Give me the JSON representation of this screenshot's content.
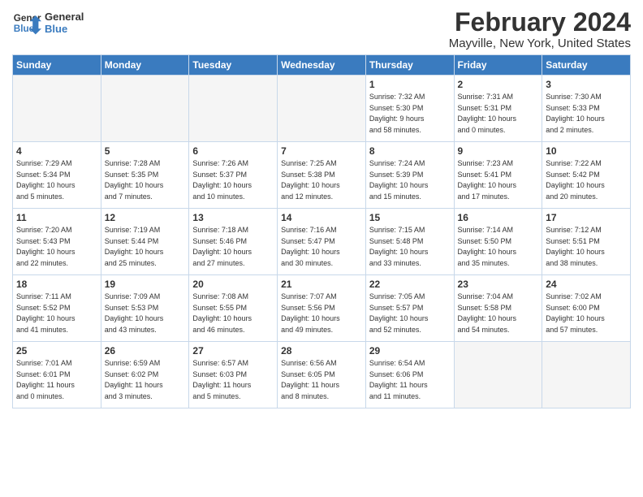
{
  "logo": {
    "general": "General",
    "blue": "Blue"
  },
  "header": {
    "month": "February 2024",
    "location": "Mayville, New York, United States"
  },
  "weekdays": [
    "Sunday",
    "Monday",
    "Tuesday",
    "Wednesday",
    "Thursday",
    "Friday",
    "Saturday"
  ],
  "weeks": [
    [
      {
        "day": "",
        "info": ""
      },
      {
        "day": "",
        "info": ""
      },
      {
        "day": "",
        "info": ""
      },
      {
        "day": "",
        "info": ""
      },
      {
        "day": "1",
        "info": "Sunrise: 7:32 AM\nSunset: 5:30 PM\nDaylight: 9 hours\nand 58 minutes."
      },
      {
        "day": "2",
        "info": "Sunrise: 7:31 AM\nSunset: 5:31 PM\nDaylight: 10 hours\nand 0 minutes."
      },
      {
        "day": "3",
        "info": "Sunrise: 7:30 AM\nSunset: 5:33 PM\nDaylight: 10 hours\nand 2 minutes."
      }
    ],
    [
      {
        "day": "4",
        "info": "Sunrise: 7:29 AM\nSunset: 5:34 PM\nDaylight: 10 hours\nand 5 minutes."
      },
      {
        "day": "5",
        "info": "Sunrise: 7:28 AM\nSunset: 5:35 PM\nDaylight: 10 hours\nand 7 minutes."
      },
      {
        "day": "6",
        "info": "Sunrise: 7:26 AM\nSunset: 5:37 PM\nDaylight: 10 hours\nand 10 minutes."
      },
      {
        "day": "7",
        "info": "Sunrise: 7:25 AM\nSunset: 5:38 PM\nDaylight: 10 hours\nand 12 minutes."
      },
      {
        "day": "8",
        "info": "Sunrise: 7:24 AM\nSunset: 5:39 PM\nDaylight: 10 hours\nand 15 minutes."
      },
      {
        "day": "9",
        "info": "Sunrise: 7:23 AM\nSunset: 5:41 PM\nDaylight: 10 hours\nand 17 minutes."
      },
      {
        "day": "10",
        "info": "Sunrise: 7:22 AM\nSunset: 5:42 PM\nDaylight: 10 hours\nand 20 minutes."
      }
    ],
    [
      {
        "day": "11",
        "info": "Sunrise: 7:20 AM\nSunset: 5:43 PM\nDaylight: 10 hours\nand 22 minutes."
      },
      {
        "day": "12",
        "info": "Sunrise: 7:19 AM\nSunset: 5:44 PM\nDaylight: 10 hours\nand 25 minutes."
      },
      {
        "day": "13",
        "info": "Sunrise: 7:18 AM\nSunset: 5:46 PM\nDaylight: 10 hours\nand 27 minutes."
      },
      {
        "day": "14",
        "info": "Sunrise: 7:16 AM\nSunset: 5:47 PM\nDaylight: 10 hours\nand 30 minutes."
      },
      {
        "day": "15",
        "info": "Sunrise: 7:15 AM\nSunset: 5:48 PM\nDaylight: 10 hours\nand 33 minutes."
      },
      {
        "day": "16",
        "info": "Sunrise: 7:14 AM\nSunset: 5:50 PM\nDaylight: 10 hours\nand 35 minutes."
      },
      {
        "day": "17",
        "info": "Sunrise: 7:12 AM\nSunset: 5:51 PM\nDaylight: 10 hours\nand 38 minutes."
      }
    ],
    [
      {
        "day": "18",
        "info": "Sunrise: 7:11 AM\nSunset: 5:52 PM\nDaylight: 10 hours\nand 41 minutes."
      },
      {
        "day": "19",
        "info": "Sunrise: 7:09 AM\nSunset: 5:53 PM\nDaylight: 10 hours\nand 43 minutes."
      },
      {
        "day": "20",
        "info": "Sunrise: 7:08 AM\nSunset: 5:55 PM\nDaylight: 10 hours\nand 46 minutes."
      },
      {
        "day": "21",
        "info": "Sunrise: 7:07 AM\nSunset: 5:56 PM\nDaylight: 10 hours\nand 49 minutes."
      },
      {
        "day": "22",
        "info": "Sunrise: 7:05 AM\nSunset: 5:57 PM\nDaylight: 10 hours\nand 52 minutes."
      },
      {
        "day": "23",
        "info": "Sunrise: 7:04 AM\nSunset: 5:58 PM\nDaylight: 10 hours\nand 54 minutes."
      },
      {
        "day": "24",
        "info": "Sunrise: 7:02 AM\nSunset: 6:00 PM\nDaylight: 10 hours\nand 57 minutes."
      }
    ],
    [
      {
        "day": "25",
        "info": "Sunrise: 7:01 AM\nSunset: 6:01 PM\nDaylight: 11 hours\nand 0 minutes."
      },
      {
        "day": "26",
        "info": "Sunrise: 6:59 AM\nSunset: 6:02 PM\nDaylight: 11 hours\nand 3 minutes."
      },
      {
        "day": "27",
        "info": "Sunrise: 6:57 AM\nSunset: 6:03 PM\nDaylight: 11 hours\nand 5 minutes."
      },
      {
        "day": "28",
        "info": "Sunrise: 6:56 AM\nSunset: 6:05 PM\nDaylight: 11 hours\nand 8 minutes."
      },
      {
        "day": "29",
        "info": "Sunrise: 6:54 AM\nSunset: 6:06 PM\nDaylight: 11 hours\nand 11 minutes."
      },
      {
        "day": "",
        "info": ""
      },
      {
        "day": "",
        "info": ""
      }
    ]
  ]
}
